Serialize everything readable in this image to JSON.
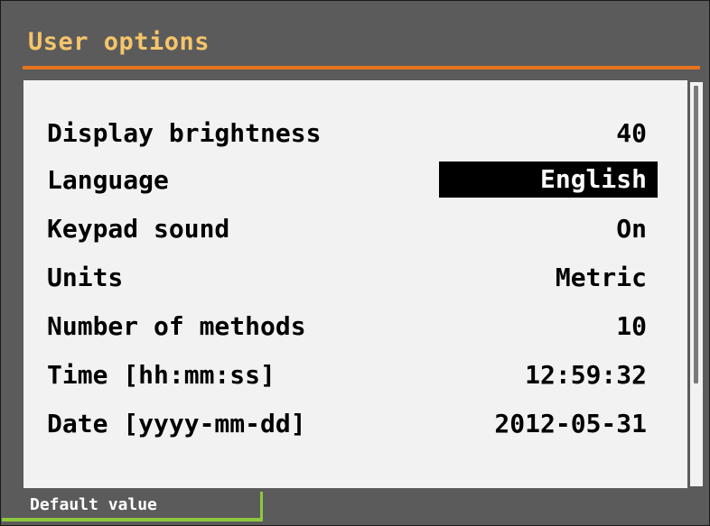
{
  "header": {
    "title": "User options"
  },
  "options": [
    {
      "label": "Display brightness",
      "value": "40",
      "selected": false
    },
    {
      "label": "Language",
      "value": "English",
      "selected": true
    },
    {
      "label": "Keypad sound",
      "value": "On",
      "selected": false
    },
    {
      "label": "Units",
      "value": "Metric",
      "selected": false
    },
    {
      "label": "Number of methods",
      "value": "10",
      "selected": false
    },
    {
      "label": "Time [hh:mm:ss]",
      "value": "12:59:32",
      "selected": false
    },
    {
      "label": "Date [yyyy-mm-dd]",
      "value": "2012-05-31",
      "selected": false
    }
  ],
  "softkeys": {
    "default_value": "Default value"
  },
  "colors": {
    "background": "#5b5b5b",
    "title_text": "#f6c56a",
    "accent_rule": "#e8731f",
    "panel": "#f2f2f2",
    "selection": "#000000",
    "softkey_border": "#8ec63f"
  },
  "scrollbar": {
    "visible_fraction": 0.75,
    "position_fraction": 0
  }
}
